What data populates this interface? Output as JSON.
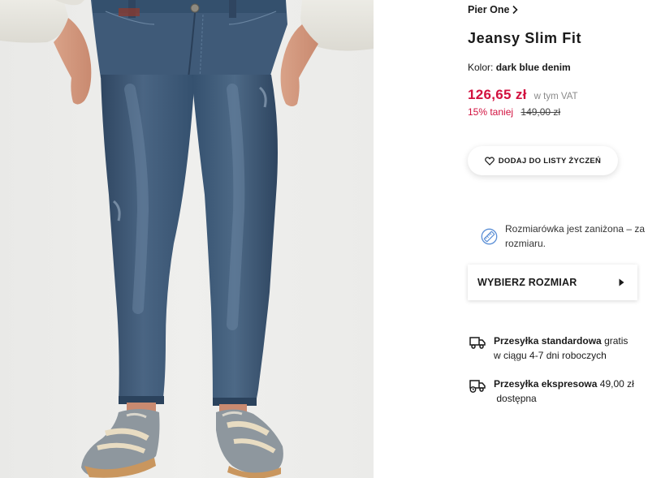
{
  "product": {
    "brand": "Pier One",
    "brand_link_icon": "chevron-right-icon",
    "title": "Jeansy Slim Fit",
    "color_label": "Kolor:",
    "color_value": "dark blue denim",
    "price": "126,65 zł",
    "vat_note": "w tym VAT",
    "discount": "15% taniej",
    "old_price": "149,00 zł",
    "image_alt": "Jeansy Slim Fit – Pier One"
  },
  "wishlist": {
    "label": "DODAJ DO LISTY ŻYCZEŃ",
    "icon": "heart-icon"
  },
  "size_note": {
    "icon": "ruler-icon",
    "line1": "Rozmiarówka jest zaniżona – za",
    "line2": "rozmiaru."
  },
  "size_select": {
    "label": "WYBIERZ ROZMIAR",
    "icon": "play-arrow-icon"
  },
  "shipping": [
    {
      "icon": "truck-icon",
      "name": "Przesyłka standardowa",
      "price": "gratis",
      "detail": "w ciągu 4-7 dni roboczych"
    },
    {
      "icon": "express-truck-icon",
      "name": "Przesyłka ekspresowa",
      "price": "49,00 zł",
      "detail": "dostępna"
    }
  ],
  "colors": {
    "price_red": "#d2113f",
    "text_dark": "#1a1a1a",
    "icon_blue": "#5b8fd6",
    "denim": "#3d5673"
  }
}
